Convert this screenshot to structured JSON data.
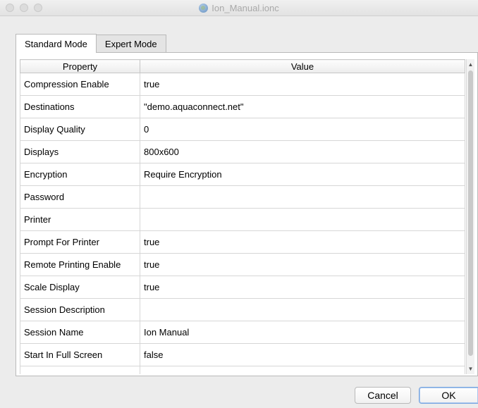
{
  "window": {
    "title": "Ion_Manual.ionc",
    "icon": "globe-icon"
  },
  "tabs": [
    {
      "label": "Standard Mode",
      "active": true
    },
    {
      "label": "Expert Mode",
      "active": false
    }
  ],
  "table": {
    "headers": {
      "property": "Property",
      "value": "Value"
    },
    "rows": [
      {
        "property": "Compression Enable",
        "value": "true"
      },
      {
        "property": "Destinations",
        "value": "\"demo.aquaconnect.net\""
      },
      {
        "property": "Display Quality",
        "value": "0"
      },
      {
        "property": "Displays",
        "value": "800x600"
      },
      {
        "property": "Encryption",
        "value": "Require Encryption"
      },
      {
        "property": "Password",
        "value": ""
      },
      {
        "property": "Printer",
        "value": ""
      },
      {
        "property": "Prompt For Printer",
        "value": "true"
      },
      {
        "property": "Remote Printing Enable",
        "value": "true"
      },
      {
        "property": "Scale Display",
        "value": "true"
      },
      {
        "property": "Session Description",
        "value": ""
      },
      {
        "property": "Session Name",
        "value": "Ion Manual"
      },
      {
        "property": "Start In Full Screen",
        "value": "false"
      }
    ]
  },
  "buttons": {
    "cancel": "Cancel",
    "ok": "OK"
  },
  "colors": {
    "window_bg": "#ececec",
    "panel_bg": "#ffffff",
    "ok_border": "#7aa7e0"
  }
}
